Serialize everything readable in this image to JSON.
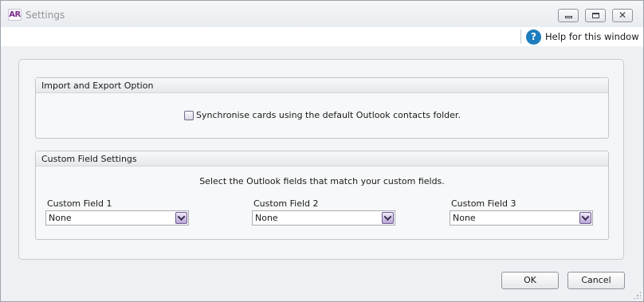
{
  "window": {
    "logo_text": "AR",
    "title": "Settings",
    "controls": {
      "minimize_icon": "minimize-icon",
      "maximize_icon": "restore-icon",
      "close_icon": "close-icon",
      "close_glyph": "✕"
    }
  },
  "help": {
    "icon_glyph": "?",
    "label": "Help for this window"
  },
  "import_export": {
    "header": "Import and Export Option",
    "sync_label": "Synchronise cards using the default Outlook contacts folder.",
    "sync_checked": false
  },
  "custom_fields": {
    "header": "Custom Field Settings",
    "hint": "Select the Outlook fields that match your custom fields.",
    "fields": [
      {
        "label": "Custom Field 1",
        "value": "None"
      },
      {
        "label": "Custom Field 2",
        "value": "None"
      },
      {
        "label": "Custom Field 3",
        "value": "None"
      }
    ]
  },
  "footer": {
    "ok_label": "OK",
    "cancel_label": "Cancel"
  },
  "colors": {
    "accent_purple": "#7a2a8c",
    "help_blue": "#1e7dbf"
  }
}
